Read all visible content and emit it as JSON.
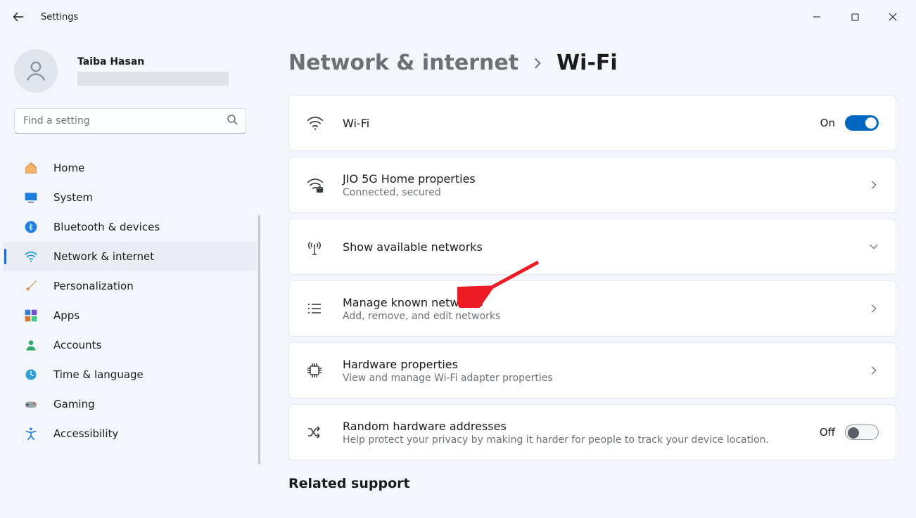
{
  "window": {
    "title": "Settings"
  },
  "user": {
    "name": "Taiba Hasan"
  },
  "search": {
    "placeholder": "Find a setting"
  },
  "nav": {
    "items": [
      {
        "label": "Home"
      },
      {
        "label": "System"
      },
      {
        "label": "Bluetooth & devices"
      },
      {
        "label": "Network & internet"
      },
      {
        "label": "Personalization"
      },
      {
        "label": "Apps"
      },
      {
        "label": "Accounts"
      },
      {
        "label": "Time & language"
      },
      {
        "label": "Gaming"
      },
      {
        "label": "Accessibility"
      }
    ],
    "selected_index": 3
  },
  "breadcrumb": {
    "parent": "Network & internet",
    "current": "Wi-Fi"
  },
  "cards": {
    "wifi": {
      "title": "Wi-Fi",
      "state_label": "On",
      "on": true
    },
    "current_network": {
      "title": "JIO 5G Home properties",
      "sub": "Connected, secured"
    },
    "available": {
      "title": "Show available networks"
    },
    "known": {
      "title": "Manage known networks",
      "sub": "Add, remove, and edit networks"
    },
    "hardware": {
      "title": "Hardware properties",
      "sub": "View and manage Wi-Fi adapter properties"
    },
    "random_mac": {
      "title": "Random hardware addresses",
      "sub": "Help protect your privacy by making it harder for people to track your device location.",
      "state_label": "Off",
      "on": false
    }
  },
  "related": {
    "title": "Related support"
  }
}
